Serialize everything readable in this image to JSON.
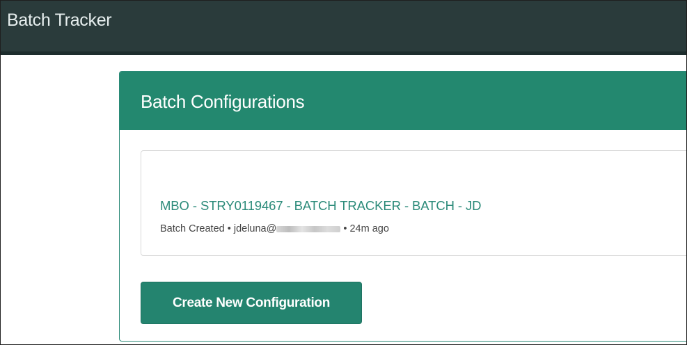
{
  "app": {
    "title": "Batch Tracker"
  },
  "panel": {
    "title": "Batch Configurations"
  },
  "configurations": [
    {
      "name": "MBO - STRY0119467 - BATCH TRACKER - BATCH - JD",
      "status": "Batch Created",
      "separator": "•",
      "user": "jdeluna@",
      "time": "24m ago"
    }
  ],
  "actions": {
    "create_label": "Create New Configuration"
  },
  "colors": {
    "topbar": "#2a3b3b",
    "accent": "#23886f",
    "link": "#2c8b7a"
  }
}
